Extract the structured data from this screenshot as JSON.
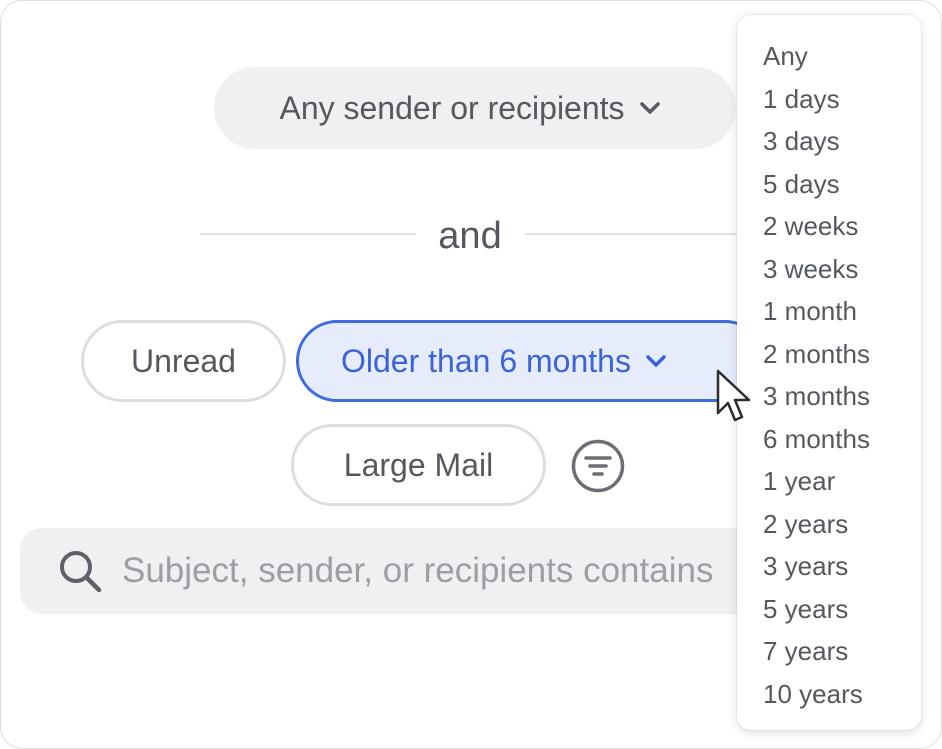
{
  "filters": {
    "sender_label": "Any sender or recipients",
    "and_label": "and",
    "unread_label": "Unread",
    "older_label": "Older than 6 months",
    "large_mail_label": "Large Mail"
  },
  "search": {
    "placeholder": "Subject, sender, or recipients contains"
  },
  "dropdown": {
    "options": [
      "Any",
      "1 days",
      "3 days",
      "5 days",
      "2 weeks",
      "3 weeks",
      "1 month",
      "2 months",
      "3 months",
      "6 months",
      "1 year",
      "2 years",
      "3 years",
      "5 years",
      "7 years",
      "10 years"
    ]
  },
  "colors": {
    "accent": "#3e6ce0",
    "accent_bg": "#e7ecfc",
    "pill_bg": "#eff0f2",
    "text": "#55585e"
  }
}
